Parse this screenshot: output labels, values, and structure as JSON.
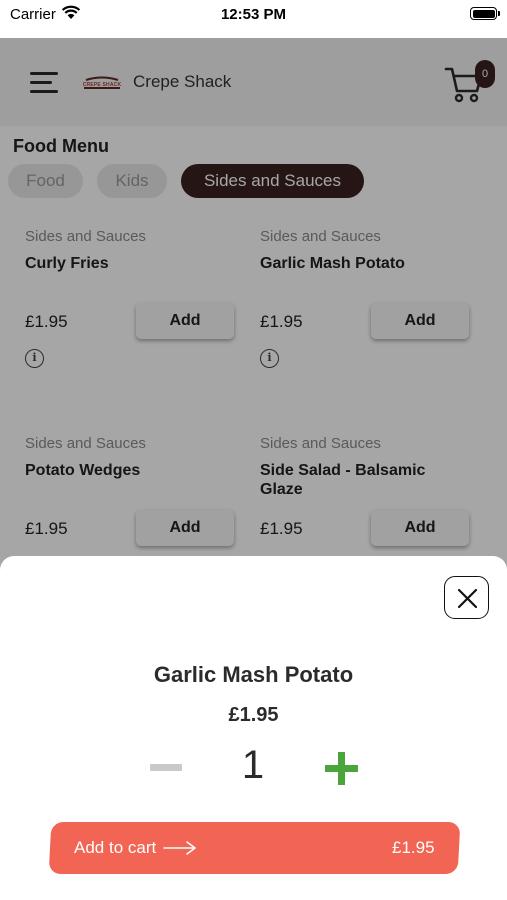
{
  "status_bar": {
    "carrier": "Carrier",
    "time": "12:53 PM"
  },
  "header": {
    "title": "Crepe Shack",
    "logo_text": "CREPE SHACK",
    "cart_count": "0"
  },
  "menu": {
    "heading": "Food Menu",
    "tabs": [
      {
        "label": "Food",
        "active": false
      },
      {
        "label": "Kids",
        "active": false
      },
      {
        "label": "Sides and Sauces",
        "active": true
      }
    ],
    "items": [
      {
        "category": "Sides and Sauces",
        "name": "Curly Fries",
        "price": "£1.95",
        "button": "Add"
      },
      {
        "category": "Sides and Sauces",
        "name": "Garlic Mash Potato",
        "price": "£1.95",
        "button": "Add"
      },
      {
        "category": "Sides and Sauces",
        "name": "Potato Wedges",
        "price": "£1.95",
        "button": "Add"
      },
      {
        "category": "Sides and Sauces",
        "name": "Side Salad - Balsamic Glaze",
        "price": "£1.95",
        "button": "Add"
      }
    ]
  },
  "sheet": {
    "item_name": "Garlic Mash Potato",
    "price": "£1.95",
    "quantity": "1",
    "add_to_cart_label": "Add to cart",
    "total": "£1.95"
  },
  "colors": {
    "accent": "#f26454",
    "active_tab": "#3a2121",
    "plus": "#4aa53b",
    "minus": "#c9c9c9"
  },
  "icons": [
    "wifi-icon",
    "battery-icon",
    "menu-icon",
    "cart-icon",
    "info-icon",
    "close-icon",
    "minus-icon",
    "plus-icon",
    "arrow-right-icon"
  ]
}
